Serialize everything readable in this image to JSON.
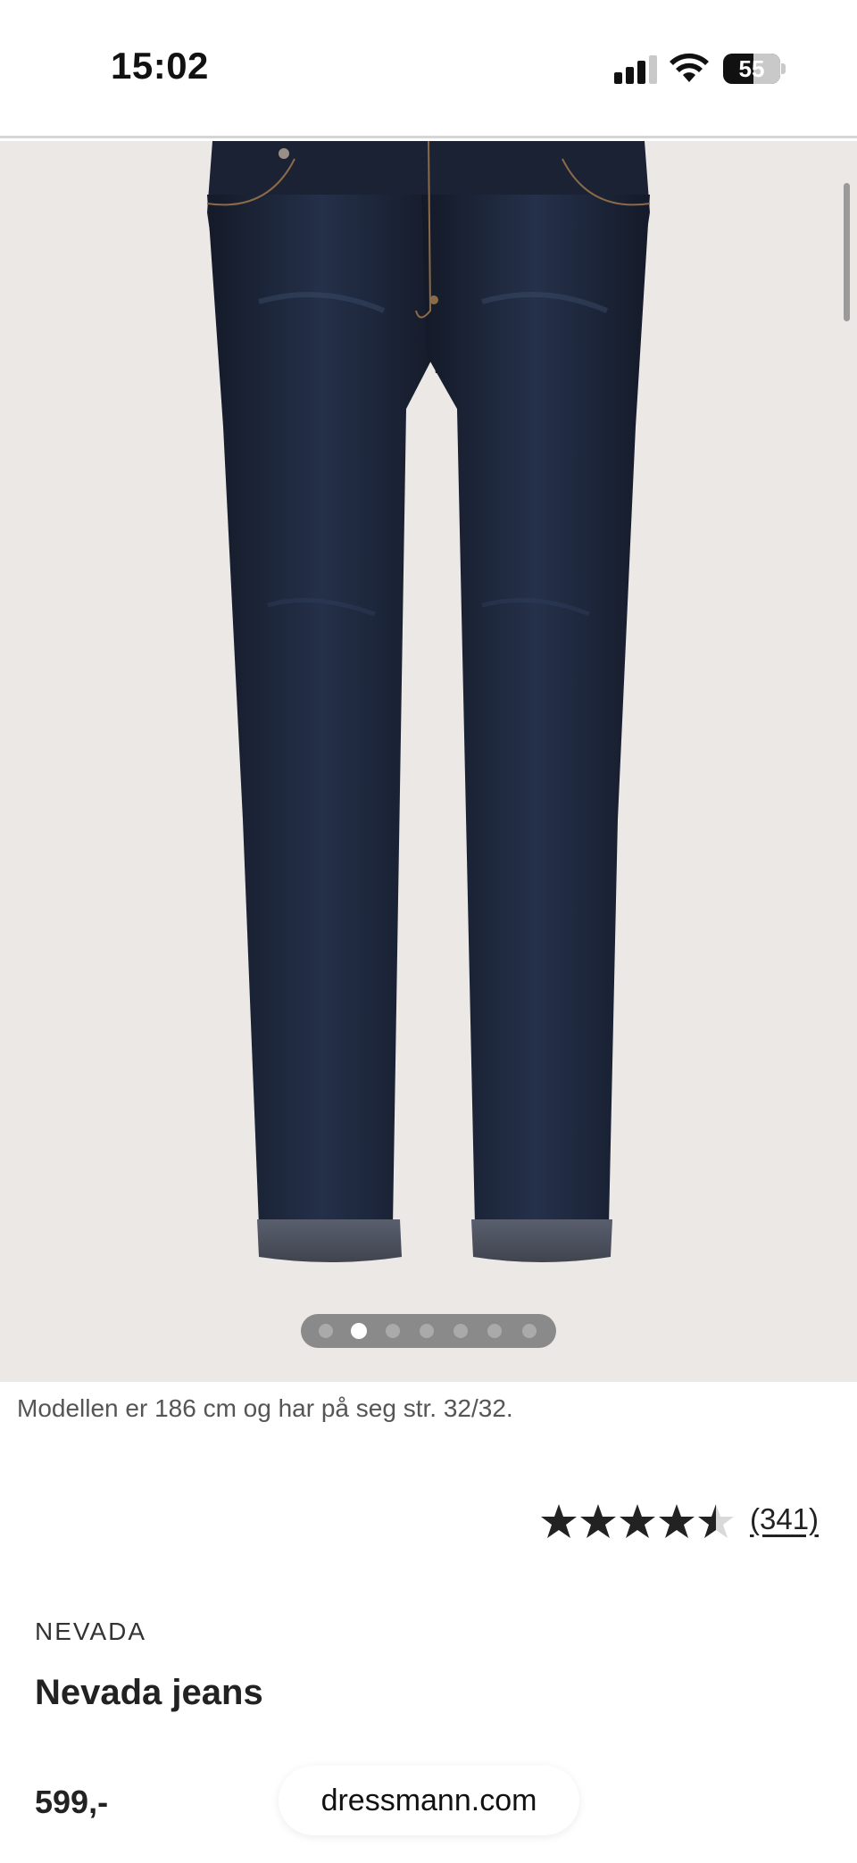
{
  "status_bar": {
    "time": "15:02",
    "battery": "55",
    "icons": [
      "signal-icon",
      "wifi-icon",
      "battery-icon"
    ]
  },
  "gallery": {
    "image_alt": "product-photo-jeans",
    "slide_count": 7,
    "active_slide": 2,
    "background_color": "#ebe8e6"
  },
  "model_note": "Modellen er 186 cm og har på seg str. 32/32.",
  "rating": {
    "stars": 4.5,
    "max": 5,
    "review_count": "(341)"
  },
  "product": {
    "brand": "NEVADA",
    "name": "Nevada jeans",
    "price": "599,-"
  },
  "browser": {
    "url": "dressmann.com"
  }
}
